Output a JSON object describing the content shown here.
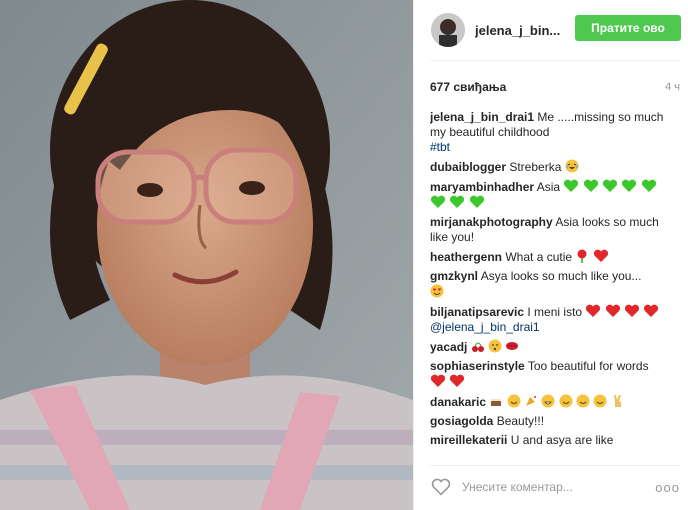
{
  "post": {
    "username": "jelena_j_bin...",
    "follow_label": "Пратите ово",
    "likes": "677 свиђања",
    "time": "4 ч"
  },
  "colors": {
    "follow_green": "#4fc84f",
    "heart_red": "#e0282b",
    "emoji_green": "#3cc82a",
    "hashtag_blue": "#003569"
  },
  "comments": [
    {
      "user": "jelena_j_bin_drai1",
      "text": "Me .....missing so much my beautiful childhood",
      "hashtag": "#tbt"
    },
    {
      "user": "dubaiblogger",
      "text": "Streberka"
    },
    {
      "user": "maryambinhadher",
      "text": "Asia"
    },
    {
      "user": "mirjanakphotography",
      "text": "Asia looks so much like you!"
    },
    {
      "user": "heathergenn",
      "text": "What a cutie"
    },
    {
      "user": "gmzkynl",
      "text": "Asya looks so much like you..."
    },
    {
      "user": "biljanatipsarevic",
      "text": "I meni isto",
      "mention": "@jelena_j_bin_drai1"
    },
    {
      "user": "yacadj",
      "text": ""
    },
    {
      "user": "sophiaserinstyle",
      "text": "Too beautiful for words"
    },
    {
      "user": "danakaric",
      "text": ""
    },
    {
      "user": "gosiagolda",
      "text": "Beauty!!!"
    },
    {
      "user": "mireillekaterii",
      "text": "U and asya are like"
    }
  ],
  "compose": {
    "placeholder": "Унесите коментар...",
    "more": "ooo"
  },
  "icons": [
    "heart-outline-icon",
    "more-options-icon"
  ]
}
